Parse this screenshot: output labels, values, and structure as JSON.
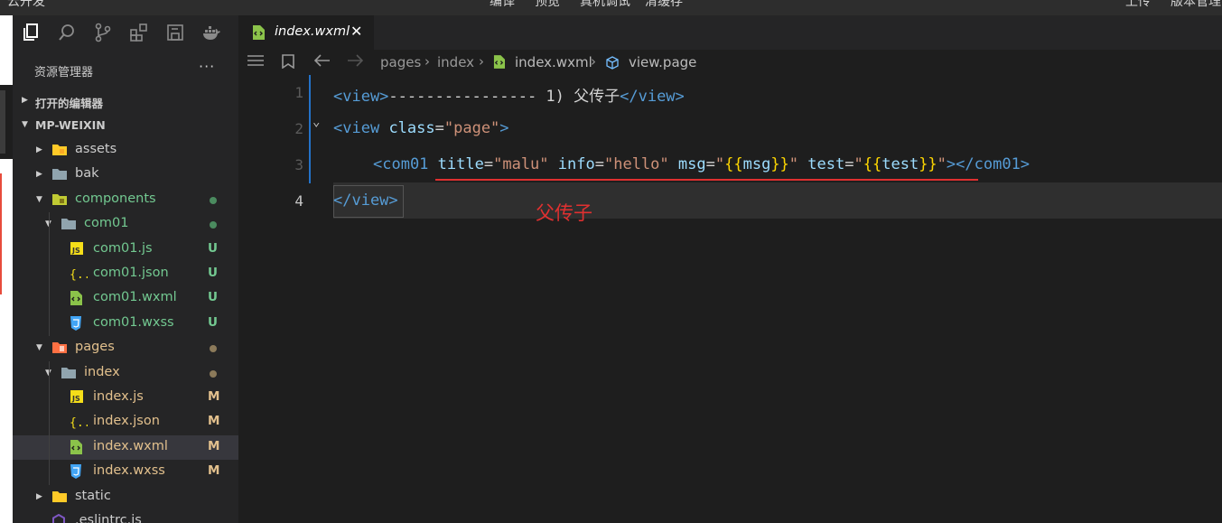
{
  "topbar": {
    "left": "云开发",
    "menu": [
      "编译",
      "预览",
      "真机调试",
      "清缓存"
    ],
    "right": [
      "上传",
      "版本管理"
    ]
  },
  "sidebar": {
    "explorer_title": "资源管理器",
    "more": "···",
    "open_editors": "打开的编辑器",
    "project": "MP-WEIXIN",
    "tree": [
      {
        "name": "assets",
        "type": "folder-assets",
        "depth": 0,
        "expanded": false,
        "status": ""
      },
      {
        "name": "bak",
        "type": "folder",
        "depth": 0,
        "expanded": false,
        "status": ""
      },
      {
        "name": "components",
        "type": "folder-components",
        "depth": 0,
        "expanded": true,
        "status": "dot"
      },
      {
        "name": "com01",
        "type": "folder",
        "depth": 1,
        "expanded": true,
        "status": "dot"
      },
      {
        "name": "com01.js",
        "type": "js",
        "depth": 2,
        "status": "U"
      },
      {
        "name": "com01.json",
        "type": "json",
        "depth": 2,
        "status": "U"
      },
      {
        "name": "com01.wxml",
        "type": "wxml",
        "depth": 2,
        "status": "U"
      },
      {
        "name": "com01.wxss",
        "type": "wxss",
        "depth": 2,
        "status": "U"
      },
      {
        "name": "pages",
        "type": "folder-pages",
        "depth": 0,
        "expanded": true,
        "status": "dot"
      },
      {
        "name": "index",
        "type": "folder",
        "depth": 1,
        "expanded": true,
        "status": "dot"
      },
      {
        "name": "index.js",
        "type": "js",
        "depth": 2,
        "status": "M"
      },
      {
        "name": "index.json",
        "type": "json",
        "depth": 2,
        "status": "M"
      },
      {
        "name": "index.wxml",
        "type": "wxml",
        "depth": 2,
        "status": "M",
        "selected": true
      },
      {
        "name": "index.wxss",
        "type": "wxss",
        "depth": 2,
        "status": "M"
      },
      {
        "name": "static",
        "type": "folder-static",
        "depth": 0,
        "expanded": false,
        "status": ""
      },
      {
        "name": ".eslintrc.js",
        "type": "eslint",
        "depth": 0,
        "status": ""
      }
    ]
  },
  "editor": {
    "tab_label": "index.wxml",
    "tab_close": "✕",
    "breadcrumbs": [
      "pages",
      "index",
      "index.wxml",
      "view.page"
    ],
    "line_numbers": [
      "1",
      "2",
      "3",
      "4"
    ],
    "annotation": "父传子"
  },
  "colors": {
    "accent_blue": "#2472c8",
    "annotation_red": "#e03030",
    "git_untracked": "#73c991",
    "git_modified": "#e2c08d"
  }
}
